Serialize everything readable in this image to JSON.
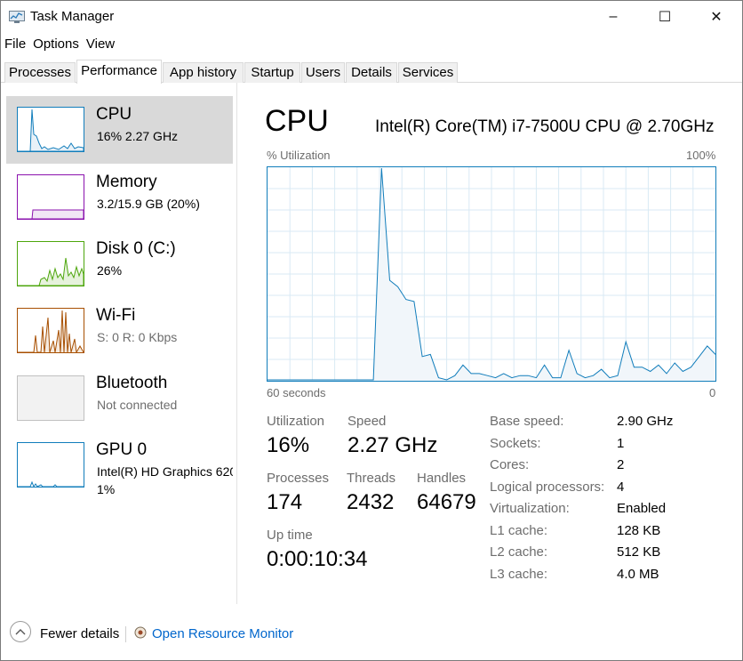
{
  "window": {
    "title": "Task Manager",
    "app_icon": "task-manager-icon",
    "controls": {
      "minimize": "–",
      "maximize": "☐",
      "close": "✕"
    }
  },
  "menu": [
    "File",
    "Options",
    "View"
  ],
  "tabs": [
    {
      "label": "Processes",
      "active": false
    },
    {
      "label": "Performance",
      "active": true
    },
    {
      "label": "App history",
      "active": false
    },
    {
      "label": "Startup",
      "active": false
    },
    {
      "label": "Users",
      "active": false
    },
    {
      "label": "Details",
      "active": false
    },
    {
      "label": "Services",
      "active": false
    }
  ],
  "sidebar": {
    "items": [
      {
        "title": "CPU",
        "line1": "16%  2.27 GHz",
        "line2": "",
        "selected": true,
        "color": "#117dbb"
      },
      {
        "title": "Memory",
        "line1": "3.2/15.9 GB (20%)",
        "line2": "",
        "selected": false,
        "color": "#8b12ae"
      },
      {
        "title": "Disk 0 (C:)",
        "line1": "26%",
        "line2": "",
        "selected": false,
        "color": "#4da60c"
      },
      {
        "title": "Wi-Fi",
        "line1": "S: 0  R: 0 Kbps",
        "line2": "",
        "selected": false,
        "color": "#a74f01"
      },
      {
        "title": "Bluetooth",
        "line1": "Not connected",
        "line2": "",
        "selected": false,
        "color": "#c0c0c0"
      },
      {
        "title": "GPU 0",
        "line1": "Intel(R) HD Graphics 620",
        "line2": "1%",
        "selected": false,
        "color": "#117dbb"
      }
    ]
  },
  "cpu": {
    "title": "CPU",
    "model": "Intel(R) Core(TM) i7-7500U CPU @ 2.70GHz",
    "graph_label": "% Utilization",
    "graph_max": "100%",
    "graph_time": "60 seconds",
    "graph_min": "0",
    "graph_color": "#117dbb",
    "utilization_history": [
      0,
      0,
      0,
      0,
      0,
      0,
      0,
      0,
      0,
      0,
      0,
      0,
      0,
      0,
      100,
      47,
      44,
      38,
      37,
      11,
      12,
      1,
      0,
      2,
      7,
      3,
      3,
      2,
      1,
      3,
      1,
      2,
      2,
      1,
      7,
      1,
      1,
      14,
      3,
      1,
      2,
      5,
      1,
      2,
      18,
      6,
      6,
      4,
      7,
      3,
      8,
      4,
      6,
      11,
      16,
      12
    ],
    "stats": {
      "utilization": {
        "label": "Utilization",
        "value": "16%"
      },
      "speed": {
        "label": "Speed",
        "value": "2.27 GHz"
      },
      "processes": {
        "label": "Processes",
        "value": "174"
      },
      "threads": {
        "label": "Threads",
        "value": "2432"
      },
      "handles": {
        "label": "Handles",
        "value": "64679"
      },
      "uptime": {
        "label": "Up time",
        "value": "0:00:10:34"
      }
    },
    "specs": [
      {
        "label": "Base speed:",
        "value": "2.90 GHz"
      },
      {
        "label": "Sockets:",
        "value": "1"
      },
      {
        "label": "Cores:",
        "value": "2"
      },
      {
        "label": "Logical processors:",
        "value": "4"
      },
      {
        "label": "Virtualization:",
        "value": "Enabled"
      },
      {
        "label": "L1 cache:",
        "value": "128 KB"
      },
      {
        "label": "L2 cache:",
        "value": "512 KB"
      },
      {
        "label": "L3 cache:",
        "value": "4.0 MB"
      }
    ]
  },
  "footer": {
    "fewer_details": "Fewer details",
    "open_monitor": "Open Resource Monitor"
  }
}
